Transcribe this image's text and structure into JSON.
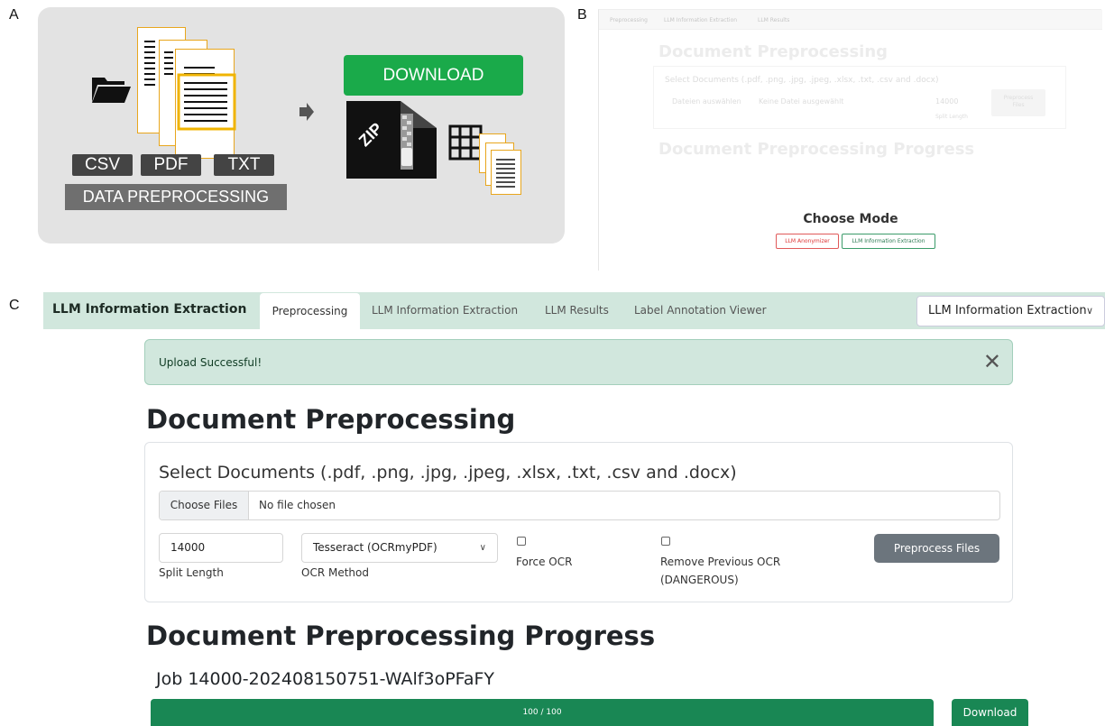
{
  "panel_labels": {
    "a": "A",
    "b": "B",
    "c": "C"
  },
  "panel_a": {
    "file_types": [
      "CSV",
      "PDF",
      "TXT"
    ],
    "preprocessing_label": "DATA PREPROCESSING",
    "download_label": "DOWNLOAD",
    "zip_label": "ZIP",
    "accent_color": "#e8a61d",
    "download_color": "#1aaa4a",
    "icons": [
      "folder-icon",
      "document-stack-icon",
      "arrow-right-icon",
      "zip-file-icon",
      "table-icon",
      "text-file-icon"
    ]
  },
  "panel_b": {
    "nav_tabs": [
      "Preprocessing",
      "LLM Information Extraction",
      "LLM Results"
    ],
    "title": "Document Preprocessing",
    "select_label": "Select Documents (.pdf, .png, .jpg, .jpeg, .xlsx, .txt, .csv and .docx)",
    "file_button": "Dateien auswählen",
    "file_status": "Keine Datei ausgewählt",
    "split_value": "14000",
    "split_label": "Split Length",
    "preprocess_button_line1": "Preprocess",
    "preprocess_button_line2": "Files",
    "progress_title": "Document Preprocessing Progress",
    "choose_mode": "Choose Mode",
    "mode_anonymizer": "LLM Anonymizer",
    "mode_extraction": "LLM Information Extraction"
  },
  "navbar": {
    "brand": "LLM Information Extraction",
    "tabs": [
      "Preprocessing",
      "LLM Information Extraction",
      "LLM Results",
      "Label Annotation Viewer"
    ],
    "active_tab": "Preprocessing",
    "mode_select": "LLM Information Extraction",
    "background_color": "#d1e7dd"
  },
  "alert": {
    "message": "Upload Successful!",
    "close_symbol": "✕"
  },
  "preprocessing": {
    "title": "Document Preprocessing",
    "select_label": "Select Documents (.pdf, .png, .jpg, .jpeg, .xlsx, .txt, .csv and .docx)",
    "file_button": "Choose Files",
    "file_status": "No file chosen",
    "split_length_value": "14000",
    "split_length_label": "Split Length",
    "ocr_method_value": "Tesseract (OCRmyPDF)",
    "ocr_method_label": "OCR Method",
    "force_ocr_label": "Force OCR",
    "force_ocr_checked": false,
    "remove_ocr_label_line1": "Remove Previous OCR",
    "remove_ocr_label_line2": "(DANGEROUS)",
    "remove_ocr_checked": false,
    "preprocess_button": "Preprocess Files"
  },
  "progress": {
    "title": "Document Preprocessing Progress",
    "job_title": "Job 14000-202408150751-WAlf3oPFaFY",
    "done": 100,
    "total": 100,
    "progress_text": "100 / 100",
    "progress_fraction": 1.0,
    "download_button": "Download",
    "bar_color": "#198754"
  }
}
